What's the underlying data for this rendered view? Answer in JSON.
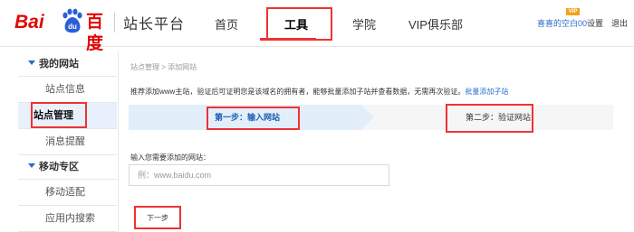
{
  "header": {
    "logo": {
      "left": "Bai",
      "paw_text": "du",
      "right": "百度"
    },
    "site_title": "站长平台",
    "nav": {
      "home": "首页",
      "tools": "工具",
      "academy": "学院",
      "vip": "VIP俱乐部"
    },
    "user_link": "喜喜的空白00",
    "vip_badge": "VIP",
    "settings": "设置",
    "logout": "退出"
  },
  "sidebar": {
    "sections": [
      {
        "title": "我的网站",
        "items": [
          "站点信息",
          "站点管理",
          "消息提醒"
        ]
      },
      {
        "title": "移动专区",
        "items": [
          "移动适配",
          "应用内搜索"
        ]
      }
    ],
    "active_item": "站点管理"
  },
  "main": {
    "breadcrumb": "站点管理 > 添加网站",
    "notice": "推荐添加www主站，验证后可证明您是该域名的拥有者，能够批量添加子站并查看数据，无需再次验证。",
    "notice_link": "批量添加子站",
    "step1": "第一步：输入网站",
    "step2": "第二步：验证网站",
    "field_label": "输入您需要添加的网站：",
    "url_placeholder": "例：www.baidu.com",
    "next_button": "下一步"
  },
  "colors": {
    "brand_red": "#e10601",
    "link_blue": "#2b6ccf",
    "highlight_box": "#e33333",
    "step_active_bg": "#e3eefb"
  },
  "icons": {
    "logo": "baidu-paw-icon",
    "section_toggle": "triangle-down-icon"
  }
}
